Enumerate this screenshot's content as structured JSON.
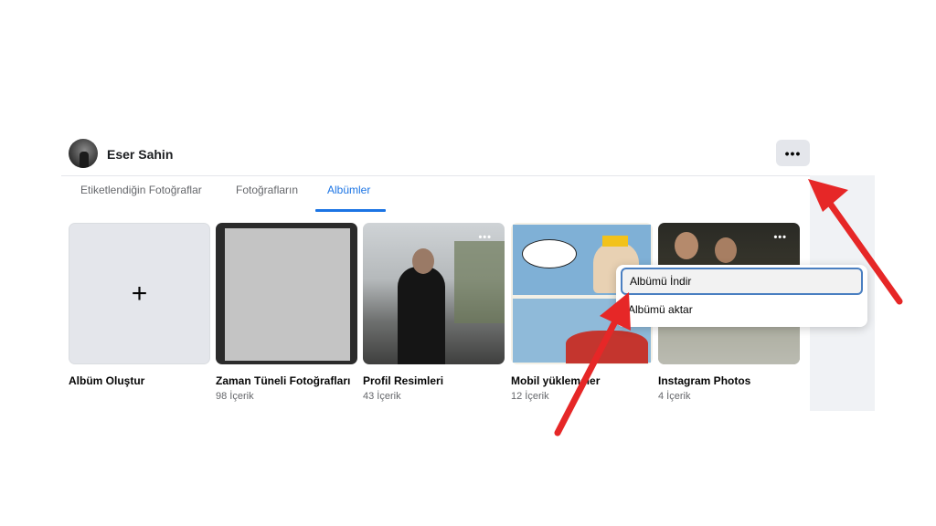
{
  "header": {
    "user_name": "Eser Sahin",
    "more_label": "•••"
  },
  "tabs": [
    {
      "label": "Etiketlendiğin Fotoğraflar",
      "active": false
    },
    {
      "label": "Fotoğrafların",
      "active": false
    },
    {
      "label": "Albümler",
      "active": true
    }
  ],
  "albums": [
    {
      "title": "Albüm Oluştur",
      "count": ""
    },
    {
      "title": "Zaman Tüneli Fotoğrafları",
      "count": "98 İçerik"
    },
    {
      "title": "Profil Resimleri",
      "count": "43 İçerik"
    },
    {
      "title": "Mobil yüklemeler",
      "count": "12 İçerik"
    },
    {
      "title": "Instagram Photos",
      "count": "4 İçerik"
    }
  ],
  "create_icon": "plus-icon",
  "card_more_label": "•••",
  "menu": {
    "items": [
      "Albümü İndir",
      "Albümü aktar"
    ]
  },
  "annotations": {
    "arrow_color": "#e62727"
  },
  "colors": {
    "accent": "#1b74e4",
    "arrow": "#e62727"
  }
}
